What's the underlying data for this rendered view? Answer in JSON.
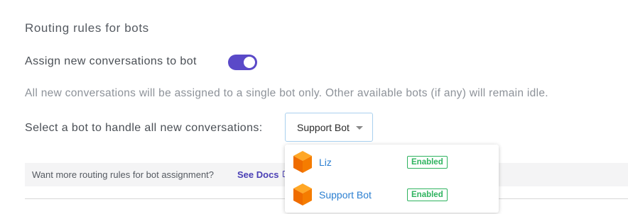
{
  "section": {
    "title": "Routing rules for bots"
  },
  "assign": {
    "label": "Assign new conversations to bot",
    "toggle_on": true,
    "help": "All new conversations will be assigned to a single bot only. Other available bots (if any) will remain idle."
  },
  "select": {
    "label": "Select a bot to handle all new conversations:",
    "value": "Support Bot"
  },
  "info": {
    "text": "Want more routing rules for bot assignment?",
    "link": "See Docs"
  },
  "dropdown": {
    "items": [
      {
        "name": "Liz",
        "status": "Enabled"
      },
      {
        "name": "Support Bot",
        "status": "Enabled"
      }
    ]
  },
  "colors": {
    "accent": "#5a49c8",
    "link": "#4a3fb5",
    "bot_name": "#2b7fd1",
    "enabled": "#2fb35f",
    "avatar": "#f57c00"
  }
}
